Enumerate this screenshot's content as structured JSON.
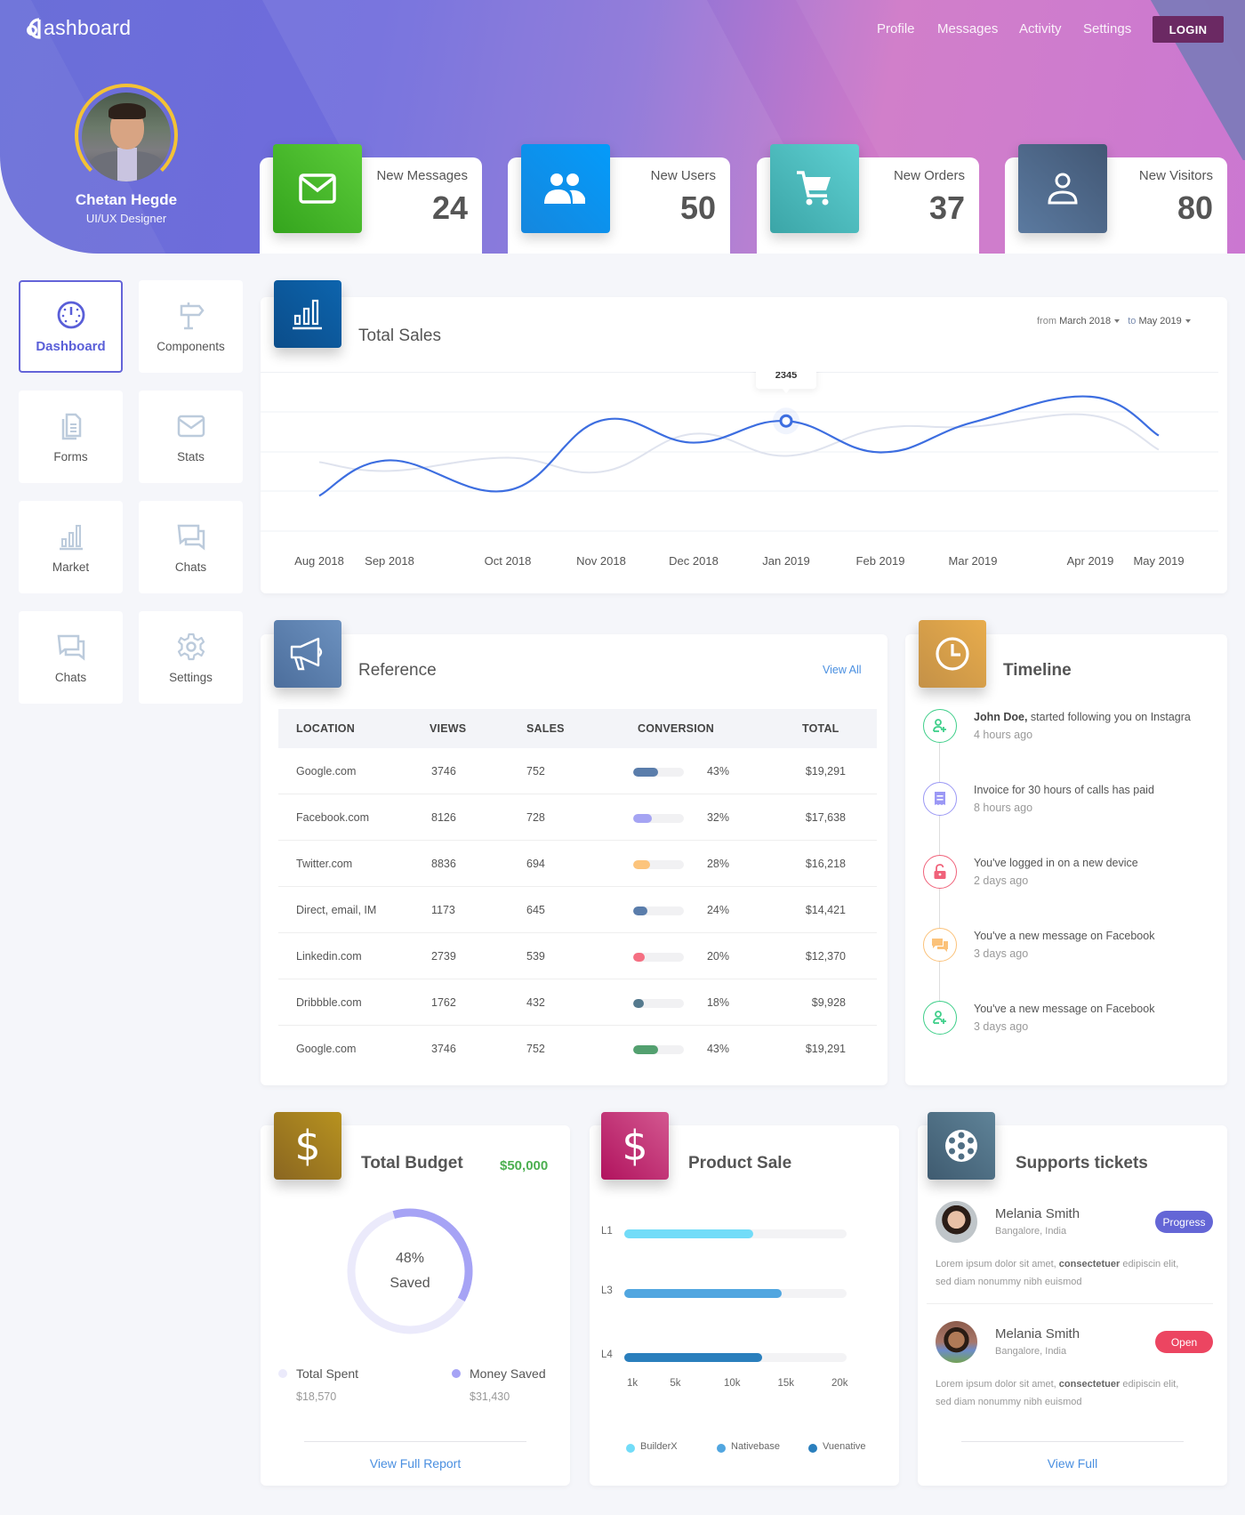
{
  "header": {
    "logo_text": "ashboard",
    "nav": [
      "Profile",
      "Messages",
      "Activity",
      "Settings"
    ],
    "login_label": "LOGIN",
    "profile": {
      "name": "Chetan Hegde",
      "role": "UI/UX Designer"
    }
  },
  "stats": [
    {
      "label": "New Messages",
      "value": "24",
      "icon": "mail-icon",
      "color": "#3fb52a"
    },
    {
      "label": "New Users",
      "value": "50",
      "icon": "users-icon",
      "color": "#1690e8"
    },
    {
      "label": "New Orders",
      "value": "37",
      "icon": "cart-icon",
      "color": "#4fbcbc"
    },
    {
      "label": "New Visitors",
      "value": "80",
      "icon": "user-icon",
      "color": "#4d6485"
    }
  ],
  "sidebar": {
    "items": [
      {
        "label": "Dashboard",
        "icon": "dashboard-icon",
        "active": true
      },
      {
        "label": "Components",
        "icon": "signpost-icon"
      },
      {
        "label": "Forms",
        "icon": "document-icon"
      },
      {
        "label": "Stats",
        "icon": "envelope-icon"
      },
      {
        "label": "Market",
        "icon": "bar-chart-icon"
      },
      {
        "label": "Chats",
        "icon": "chat-icon"
      },
      {
        "label": "Chats",
        "icon": "chat-icon"
      },
      {
        "label": "Settings",
        "icon": "gear-icon"
      }
    ]
  },
  "total_sales": {
    "title": "Total Sales",
    "from_label": "from",
    "from_value": "March 2018",
    "to_label": "to",
    "to_value": "May 2019",
    "tooltip": "2345"
  },
  "chart_data": {
    "type": "line",
    "title": "Total Sales",
    "x": [
      "Aug 2018",
      "Sep 2018",
      "Oct 2018",
      "Nov 2018",
      "Dec 2018",
      "Jan 2019",
      "Feb 2019",
      "Mar 2019",
      "Apr 2019",
      "May 2019"
    ],
    "series": [
      {
        "name": "current",
        "color": "#3d6ee0",
        "values": [
          1500,
          1900,
          1560,
          2350,
          2100,
          2345,
          1990,
          2330,
          2620,
          2180
        ]
      },
      {
        "name": "previous",
        "color": "#dfe3ee",
        "values": [
          1880,
          1780,
          1930,
          1770,
          2200,
          1950,
          2260,
          2280,
          2410,
          2020
        ]
      }
    ],
    "highlight": {
      "x": "Jan 2019",
      "value": 2345
    },
    "xlabel": "",
    "ylabel": "",
    "ylim": [
      1100,
      2900
    ],
    "grid": true
  },
  "reference": {
    "title": "Reference",
    "view_all": "View All",
    "columns": [
      "LOCATION",
      "VIEWS",
      "SALES",
      "CONVERSION",
      "TOTAL"
    ],
    "rows": [
      {
        "location": "Google.com",
        "views": "3746",
        "sales": "752",
        "conversion": 43,
        "conversion_label": "43%",
        "total": "$19,291",
        "color": "#5a7dab"
      },
      {
        "location": "Facebook.com",
        "views": "8126",
        "sales": "728",
        "conversion": 32,
        "conversion_label": "32%",
        "total": "$17,638",
        "color": "#a5a4f3"
      },
      {
        "location": "Twitter.com",
        "views": "8836",
        "sales": "694",
        "conversion": 28,
        "conversion_label": "28%",
        "total": "$16,218",
        "color": "#fcc47c"
      },
      {
        "location": "Direct, email, IM",
        "views": "1173",
        "sales": "645",
        "conversion": 24,
        "conversion_label": "24%",
        "total": "$14,421",
        "color": "#5a7dab"
      },
      {
        "location": "Linkedin.com",
        "views": "2739",
        "sales": "539",
        "conversion": 20,
        "conversion_label": "20%",
        "total": "$12,370",
        "color": "#f56f82"
      },
      {
        "location": "Dribbble.com",
        "views": "1762",
        "sales": "432",
        "conversion": 18,
        "conversion_label": "18%",
        "total": "$9,928",
        "color": "#557a8e"
      },
      {
        "location": "Google.com",
        "views": "3746",
        "sales": "752",
        "conversion": 43,
        "conversion_label": "43%",
        "total": "$19,291",
        "color": "#53a06f"
      }
    ]
  },
  "timeline": {
    "title": "Timeline",
    "items": [
      {
        "bold": "John Doe,",
        "text": " started following you on Instagra",
        "time": "4 hours ago",
        "icon": "user-plus-icon",
        "color": "#3fcf8a"
      },
      {
        "bold": "",
        "text": "Invoice for 30 hours of calls has paid",
        "time": "8 hours ago",
        "icon": "receipt-icon",
        "color": "#9b98f5"
      },
      {
        "bold": "",
        "text": "You've logged in on a new device",
        "time": "2 days ago",
        "icon": "unlock-icon",
        "color": "#f0627a"
      },
      {
        "bold": "",
        "text": "You've a new message on Facebook",
        "time": "3 days ago",
        "icon": "chat-bubbles-icon",
        "color": "#fbc27a"
      },
      {
        "bold": "",
        "text": "You've a new message on Facebook",
        "time": "3 days ago",
        "icon": "user-plus-icon",
        "color": "#3fcf8a"
      }
    ]
  },
  "budget": {
    "title": "Total Budget",
    "amount": "$50,000",
    "percent": 48,
    "percent_label": "48%",
    "center_label": "Saved",
    "spent_label": "Total Spent",
    "spent_value": "$18,570",
    "saved_label": "Money Saved",
    "saved_value": "$31,430",
    "link": "View Full Report"
  },
  "product_sale": {
    "title": "Product Sale",
    "bars": [
      {
        "label": "L1",
        "value": 12.2,
        "color": "#72dcf8"
      },
      {
        "label": "L3",
        "value": 14.9,
        "color": "#51a6e0"
      },
      {
        "label": "L4",
        "value": 13.1,
        "color": "#2a7fbd"
      }
    ],
    "ticks": [
      "1k",
      "5k",
      "10k",
      "15k",
      "20k"
    ],
    "legend": [
      {
        "label": "BuilderX",
        "color": "#72dcf8"
      },
      {
        "label": "Nativebase",
        "color": "#51a6e0"
      },
      {
        "label": "Vuenative",
        "color": "#2a7fbd"
      }
    ]
  },
  "tickets": {
    "title": "Supports tickets",
    "items": [
      {
        "name": "Melania Smith",
        "location": "Bangalore, India",
        "status": "Progress",
        "status_color": "#6466d6",
        "text_pre": "Lorem ipsum dolor sit amet, ",
        "text_bold": "consectetuer",
        "text_post": " edipiscin elit,",
        "text_line2": "sed diam nonummy nibh euismod"
      },
      {
        "name": "Melania Smith",
        "location": "Bangalore, India",
        "status": "Open",
        "status_color": "#ec4561",
        "text_pre": "Lorem ipsum dolor sit amet, ",
        "text_bold": "consectetuer",
        "text_post": " edipiscin elit,",
        "text_line2": "sed diam nonummy nibh euismod"
      }
    ],
    "link": "View Full"
  }
}
